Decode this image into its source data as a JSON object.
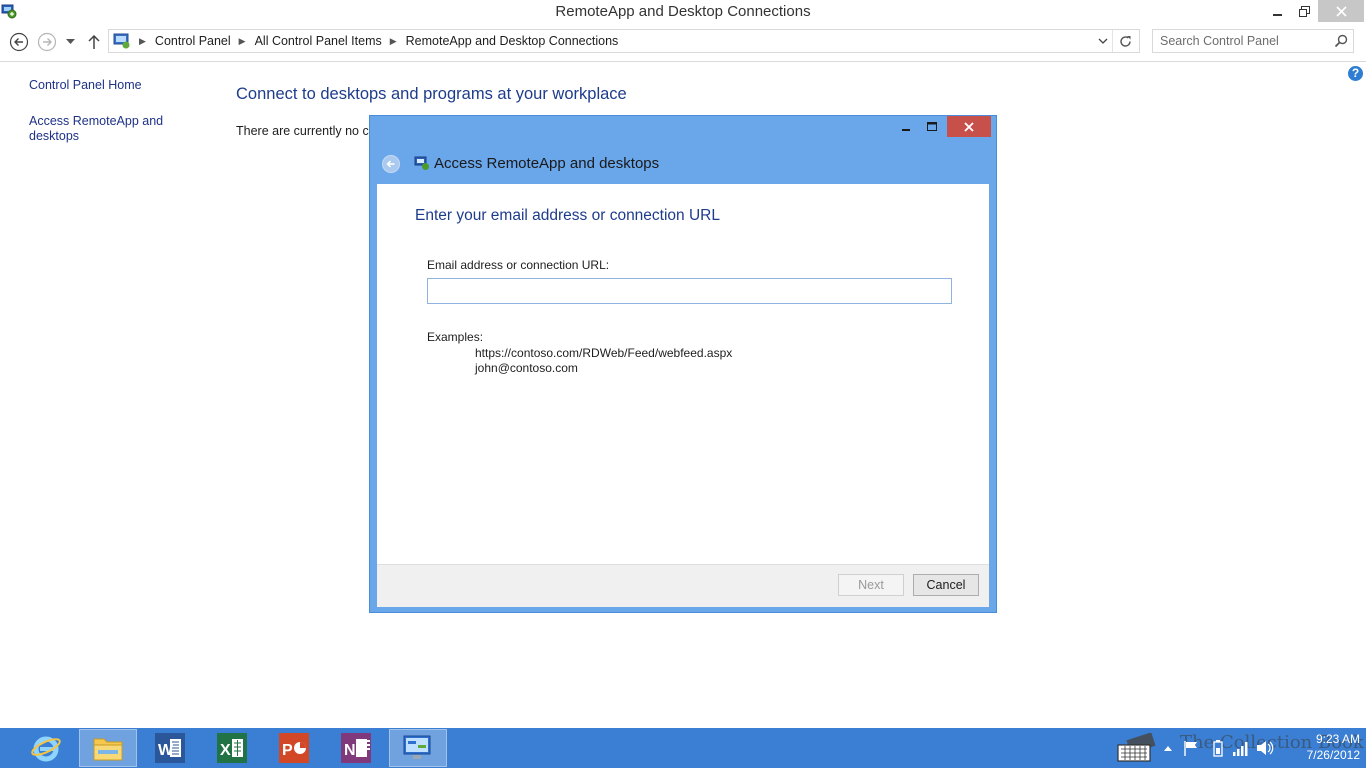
{
  "window": {
    "title": "RemoteApp and Desktop Connections"
  },
  "address_bar": {
    "crumbs": [
      "Control Panel",
      "All Control Panel Items",
      "RemoteApp and Desktop Connections"
    ]
  },
  "search": {
    "placeholder": "Search Control Panel"
  },
  "left_pane": {
    "home_link": "Control Panel Home",
    "access_link_line1": "Access RemoteApp and",
    "access_link_line2": "desktops"
  },
  "main": {
    "heading": "Connect to desktops and programs at your workplace",
    "status_text": "There are currently no co"
  },
  "help": {
    "label": "?"
  },
  "dialog": {
    "title": "Access RemoteApp and desktops",
    "heading": "Enter your email address or connection URL",
    "field_label": "Email address or connection URL:",
    "field_value": "",
    "examples_label": "Examples:",
    "examples": [
      "https://contoso.com/RDWeb/Feed/webfeed.aspx",
      "john@contoso.com"
    ],
    "next_label": "Next",
    "cancel_label": "Cancel"
  },
  "taskbar": {
    "apps": [
      {
        "name": "internet-explorer-icon"
      },
      {
        "name": "file-explorer-icon"
      },
      {
        "name": "word-icon",
        "letter": "W"
      },
      {
        "name": "excel-icon",
        "letter": "X"
      },
      {
        "name": "powerpoint-icon",
        "letter": "P"
      },
      {
        "name": "onenote-icon",
        "letter": "N"
      },
      {
        "name": "control-panel-icon"
      }
    ],
    "clock_time": "9:23 AM",
    "clock_date": "7/26/2012",
    "watermark": "The Collection Book"
  },
  "colors": {
    "accent": "#3a7fd3",
    "dialog_frame": "#6aa6ea",
    "link": "#1e3287",
    "heading": "#1e3c8c",
    "close_button": "#c7504b"
  }
}
